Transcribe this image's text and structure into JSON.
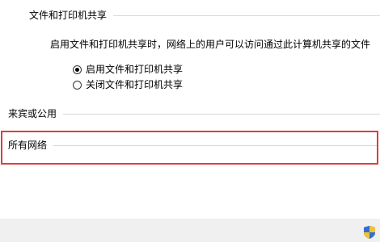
{
  "file_printer_sharing": {
    "title": "文件和打印机共享",
    "description": "启用文件和打印机共享时，网络上的用户可以访问通过此计算机共享的文件",
    "options": [
      {
        "label": "启用文件和打印机共享",
        "selected": true
      },
      {
        "label": "关闭文件和打印机共享",
        "selected": false
      }
    ]
  },
  "guest_public": {
    "title": "来宾或公用"
  },
  "all_networks": {
    "title": "所有网络"
  },
  "colors": {
    "highlight_border": "#e03c3c",
    "rule": "#d8d8d8",
    "footer_bg": "#f0f0f0"
  },
  "icons": {
    "footer": "shield-icon"
  }
}
